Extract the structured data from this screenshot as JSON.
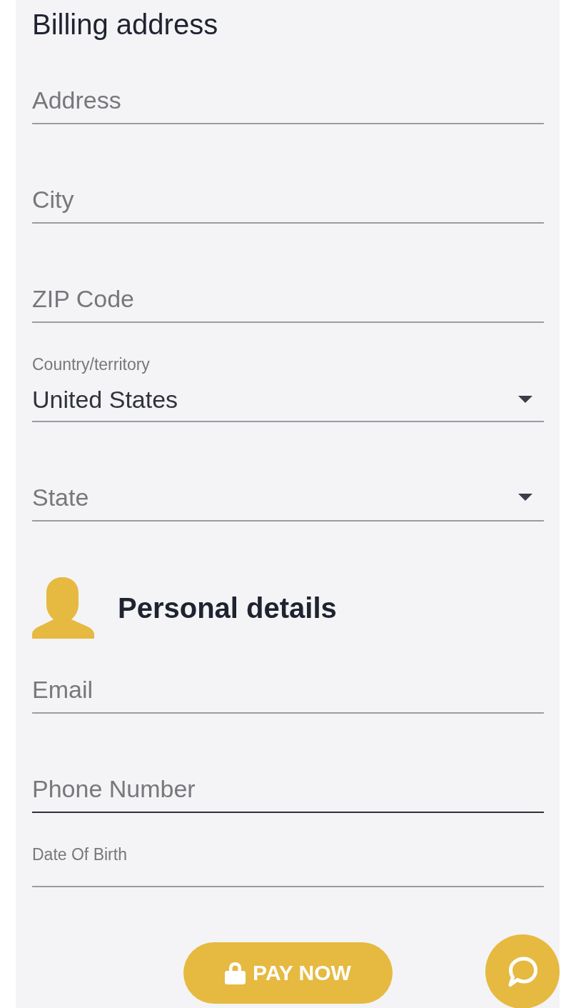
{
  "billing_address": {
    "title": "Billing address",
    "fields": [
      {
        "kind": "text",
        "placeholder": "Address",
        "focused": false
      },
      {
        "kind": "text",
        "placeholder": "City",
        "focused": false
      },
      {
        "kind": "text",
        "placeholder": "ZIP Code",
        "focused": false
      },
      {
        "kind": "select",
        "label": "Country/territory",
        "value": "United States",
        "focused": false
      },
      {
        "kind": "select",
        "placeholder": "State",
        "focused": false
      }
    ]
  },
  "personal_details": {
    "title": "Personal details",
    "fields": [
      {
        "kind": "text",
        "placeholder": "Email",
        "focused": false
      },
      {
        "kind": "text",
        "placeholder": "Phone Number",
        "focused": true
      },
      {
        "kind": "date",
        "label": "Date Of Birth",
        "focused": false
      }
    ]
  },
  "pay_button": {
    "label": "PAY NOW"
  }
}
